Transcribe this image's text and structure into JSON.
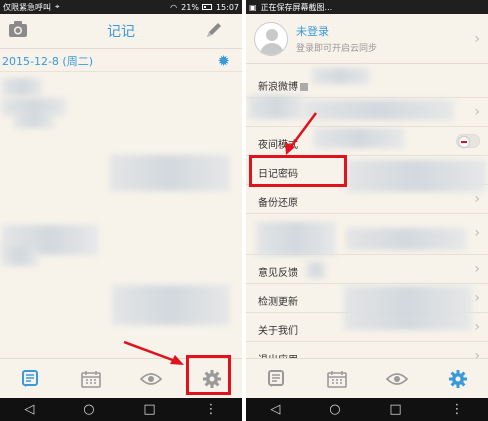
{
  "left_screen": {
    "statusbar": {
      "carrier": "仅限紧急呼叫",
      "battery": "21%",
      "time": "15:07"
    },
    "header": {
      "title": "记记",
      "camera_icon": "camera-icon",
      "edit_icon": "pencil-icon"
    },
    "date_line": "2015-12-8 (周二)",
    "weather_icon": "sun-icon",
    "tabs": [
      {
        "name": "notes",
        "icon": "notes-icon"
      },
      {
        "name": "calendar",
        "icon": "calendar-icon"
      },
      {
        "name": "view",
        "icon": "eye-icon"
      },
      {
        "name": "settings",
        "icon": "gear-icon"
      }
    ],
    "nav": {
      "back": "◁",
      "home": "○",
      "recents": "□",
      "menu": "⋮"
    }
  },
  "right_screen": {
    "statusbar": {
      "notice": "正在保存屏幕截图..."
    },
    "profile": {
      "name": "未登录",
      "subtitle": "登录即可开启云同步"
    },
    "menu_items": [
      {
        "label": "新浪微博"
      },
      {
        "label": ""
      },
      {
        "label": "夜间模式"
      },
      {
        "label": "日记密码"
      },
      {
        "label": "备份还原"
      },
      {
        "label": ""
      },
      {
        "label": "意见反馈"
      },
      {
        "label": "检测更新"
      },
      {
        "label": "关于我们"
      },
      {
        "label": "退出应用"
      }
    ],
    "tabs": [
      {
        "name": "notes",
        "icon": "notes-icon"
      },
      {
        "name": "calendar",
        "icon": "calendar-icon"
      },
      {
        "name": "view",
        "icon": "eye-icon"
      },
      {
        "name": "settings",
        "icon": "gear-icon"
      }
    ],
    "nav": {
      "back": "◁",
      "home": "○",
      "recents": "□",
      "menu": "⋮"
    }
  },
  "colors": {
    "accent": "#3a9ad9",
    "annotation": "#e1121b",
    "background": "#f7f2ea"
  }
}
